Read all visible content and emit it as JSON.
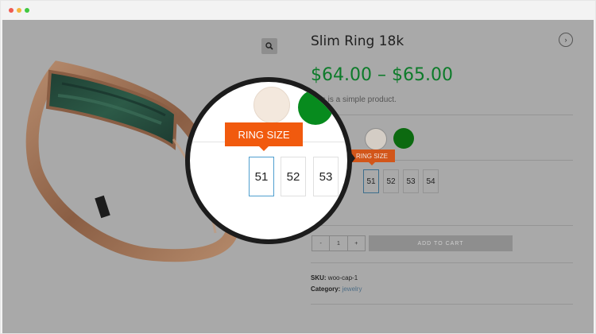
{
  "product": {
    "title": "Slim Ring 18k",
    "price": "$64.00 – $65.00",
    "description": "This is a simple product."
  },
  "colors": {
    "options": [
      "cream",
      "green"
    ],
    "cream_hex": "#d4cdc5",
    "green_hex": "#0c6a10"
  },
  "ring_size": {
    "label": "RING SIZE",
    "options": [
      "51",
      "52",
      "53",
      "54"
    ],
    "selected": "51"
  },
  "magnifier": {
    "label": "RING SIZE",
    "visible_sizes": [
      "51",
      "52",
      "53"
    ],
    "selected": "51"
  },
  "cart": {
    "decrement": "-",
    "quantity": "1",
    "increment": "+",
    "add_to_cart": "ADD TO CART"
  },
  "meta": {
    "sku_label": "SKU:",
    "sku_value": "woo-cap-1",
    "category_label": "Category:",
    "category_value": "jewelry"
  },
  "icons": {
    "zoom": "magnifier-icon",
    "next": "chevron-right-icon"
  },
  "accent": {
    "price_green": "#0d7b2a",
    "tooltip_orange": "#f15a0e",
    "selected_border": "#4f9fcf"
  }
}
